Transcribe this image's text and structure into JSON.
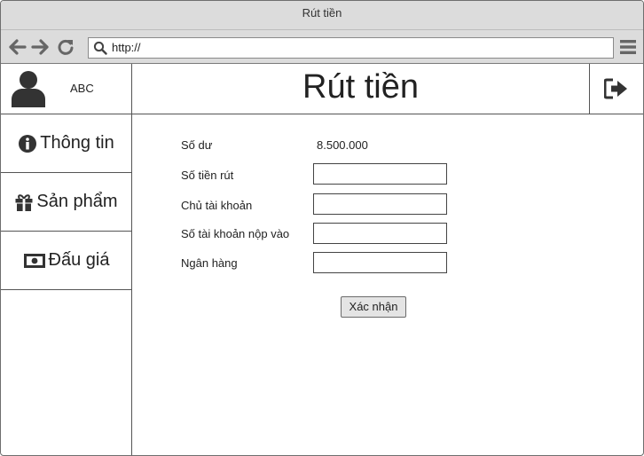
{
  "window": {
    "title": "Rút tiền"
  },
  "toolbar": {
    "url": "http://",
    "icons": [
      "back-arrow-icon",
      "forward-arrow-icon",
      "reload-icon",
      "search-icon",
      "hamburger-menu-icon"
    ]
  },
  "sidebar": {
    "user_name": "ABC",
    "items": [
      {
        "label": "Thông tin",
        "icon": "info-icon"
      },
      {
        "label": "Sản phẩm",
        "icon": "gift-icon"
      },
      {
        "label": "Đấu giá",
        "icon": "money-icon"
      }
    ]
  },
  "header": {
    "title": "Rút tiền",
    "logout_icon": "sign-out-icon"
  },
  "form": {
    "balance_label": "Số dư",
    "balance_value": "8.500.000",
    "amount_label": "Số tiền rút",
    "amount_value": "",
    "account_holder_label": "Chủ tài khoản",
    "account_holder_value": "",
    "account_number_label": "Số tài khoản nộp vào",
    "account_number_value": "",
    "bank_label": "Ngân hàng",
    "bank_value": "",
    "submit_label": "Xác nhận"
  },
  "colors": {
    "chrome": "#dcdcdc",
    "border": "#555555",
    "text": "#222222",
    "button": "#e4e4e4"
  }
}
